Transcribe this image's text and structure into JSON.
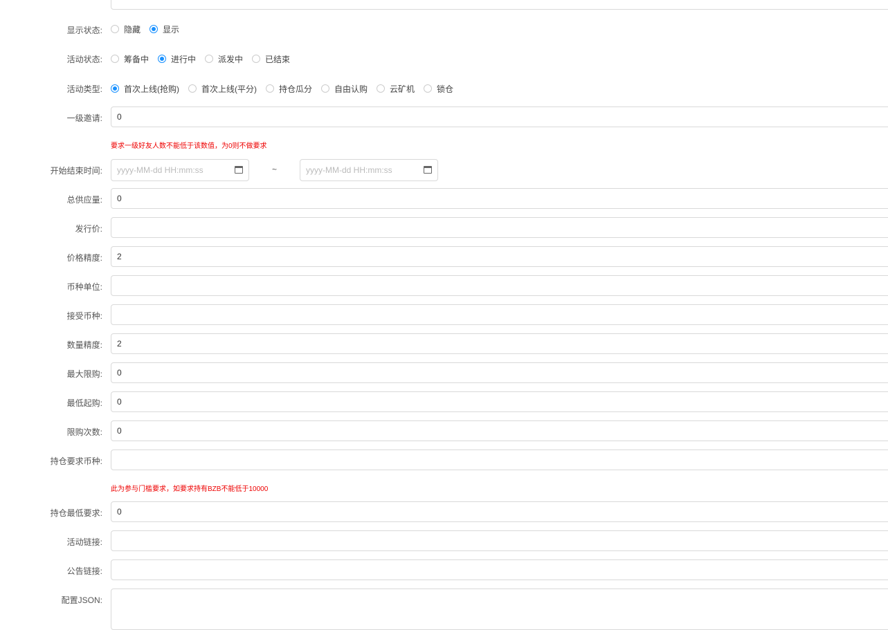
{
  "display_status": {
    "label": "显示状态:",
    "options": [
      "隐藏",
      "显示"
    ],
    "selected": "显示"
  },
  "activity_status": {
    "label": "活动状态:",
    "options": [
      "筹备中",
      "进行中",
      "派发中",
      "已结束"
    ],
    "selected": "进行中"
  },
  "activity_type": {
    "label": "活动类型:",
    "options": [
      "首次上线(抢购)",
      "首次上线(平分)",
      "持仓瓜分",
      "自由认购",
      "云矿机",
      "锁仓"
    ],
    "selected": "首次上线(抢购)"
  },
  "first_level_invite": {
    "label": "一级邀请:",
    "value": "0",
    "hint": "要求一级好友人数不能低于该数值，为0则不做要求"
  },
  "time_range": {
    "label": "开始结束时间:",
    "start_placeholder": "yyyy-MM-dd HH:mm:ss",
    "end_placeholder": "yyyy-MM-dd HH:mm:ss",
    "separator": "~"
  },
  "fields": [
    {
      "label": "总供应量:",
      "value": "0"
    },
    {
      "label": "发行价:",
      "value": ""
    },
    {
      "label": "价格精度:",
      "value": "2"
    },
    {
      "label": "币种单位:",
      "value": ""
    },
    {
      "label": "接受币种:",
      "value": ""
    },
    {
      "label": "数量精度:",
      "value": "2"
    },
    {
      "label": "最大限购:",
      "value": "0"
    },
    {
      "label": "最低起购:",
      "value": "0"
    },
    {
      "label": "限购次数:",
      "value": "0"
    }
  ],
  "holding_coin": {
    "label": "持仓要求币种:",
    "value": "",
    "hint": "此为参与门槛要求，如要求持有BZB不能低于10000"
  },
  "holding_min": {
    "label": "持仓最低要求:",
    "value": "0"
  },
  "activity_link": {
    "label": "活动链接:",
    "value": ""
  },
  "notice_link": {
    "label": "公告链接:",
    "value": ""
  },
  "config_json": {
    "label": "配置JSON:",
    "value": ""
  }
}
